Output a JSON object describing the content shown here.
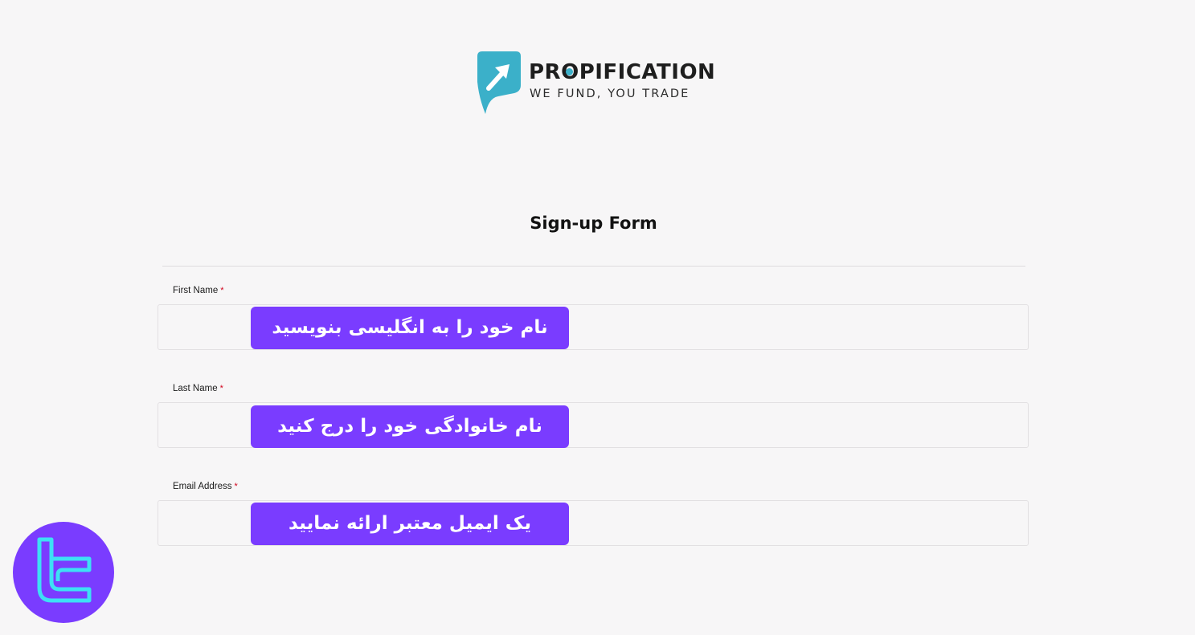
{
  "brand": {
    "name_pre": "PR",
    "name_o": "O",
    "name_post": "PIFICATION",
    "tagline": "WE FUND, YOU TRADE",
    "colors": {
      "mark": "#3bb0c9",
      "text": "#1e1e1e"
    }
  },
  "form": {
    "title": "Sign-up Form",
    "fields": [
      {
        "label": "First Name",
        "required_mark": "*",
        "hint": "نام خود را به انگلیسی بنویسید"
      },
      {
        "label": "Last Name",
        "required_mark": "*",
        "hint": "نام خانوادگی خود را درج کنید"
      },
      {
        "label": "Email Address",
        "required_mark": "*",
        "hint": "یک ایمیل معتبر ارائه نمایید"
      }
    ]
  },
  "theme": {
    "background": "#f7f6f7",
    "hint_chip": "#7a3cff",
    "required": "#d0021b",
    "watermark_circle": "#7a3cff",
    "watermark_glyph": "#3de0f5"
  },
  "icons": {
    "logo_mark": "propification-arrow-logo-icon",
    "watermark": "tc-logo-icon"
  }
}
